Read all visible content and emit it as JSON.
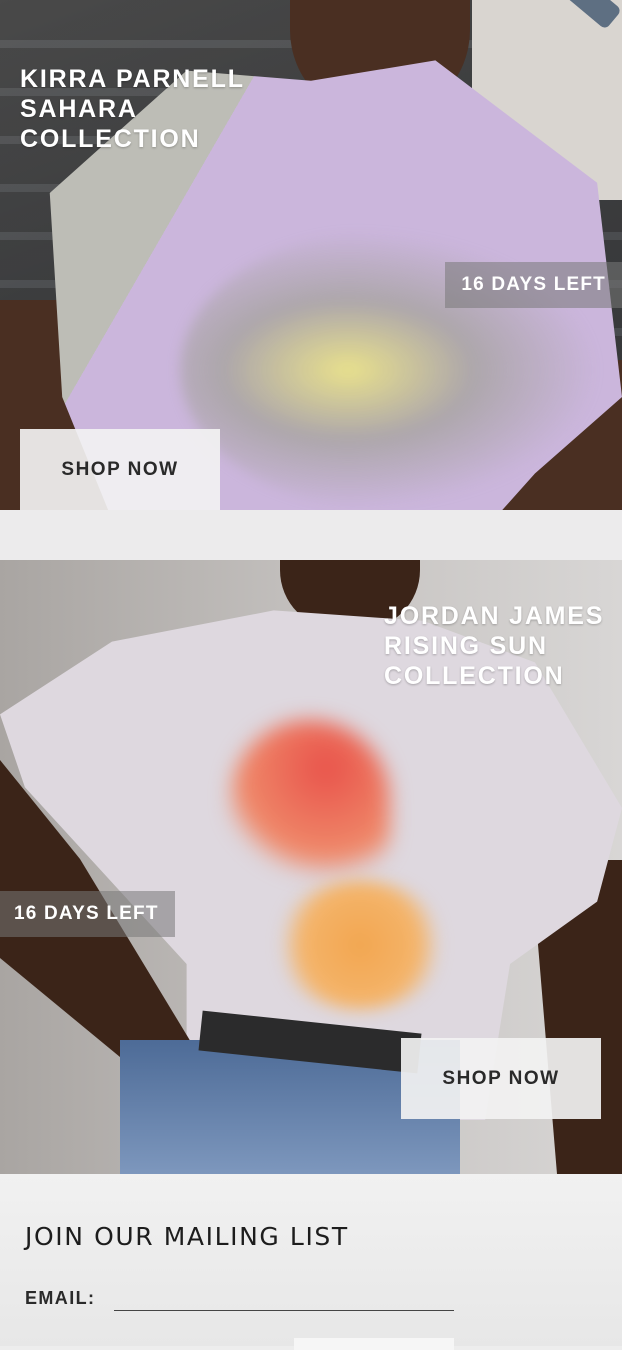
{
  "collections": [
    {
      "title_lines": [
        "KIRRA PARNELL",
        "SAHARA",
        "COLLECTION"
      ],
      "days_left": "16 DAYS LEFT",
      "cta": "SHOP NOW"
    },
    {
      "title_lines": [
        "JORDAN JAMES",
        "RISING SUN",
        "COLLECTION"
      ],
      "days_left": "16 DAYS LEFT",
      "cta": "SHOP NOW"
    }
  ],
  "mailing_list": {
    "heading": "JOIN OUR MAILING LIST",
    "email_label": "EMAIL:",
    "email_value": "",
    "email_placeholder": ""
  }
}
